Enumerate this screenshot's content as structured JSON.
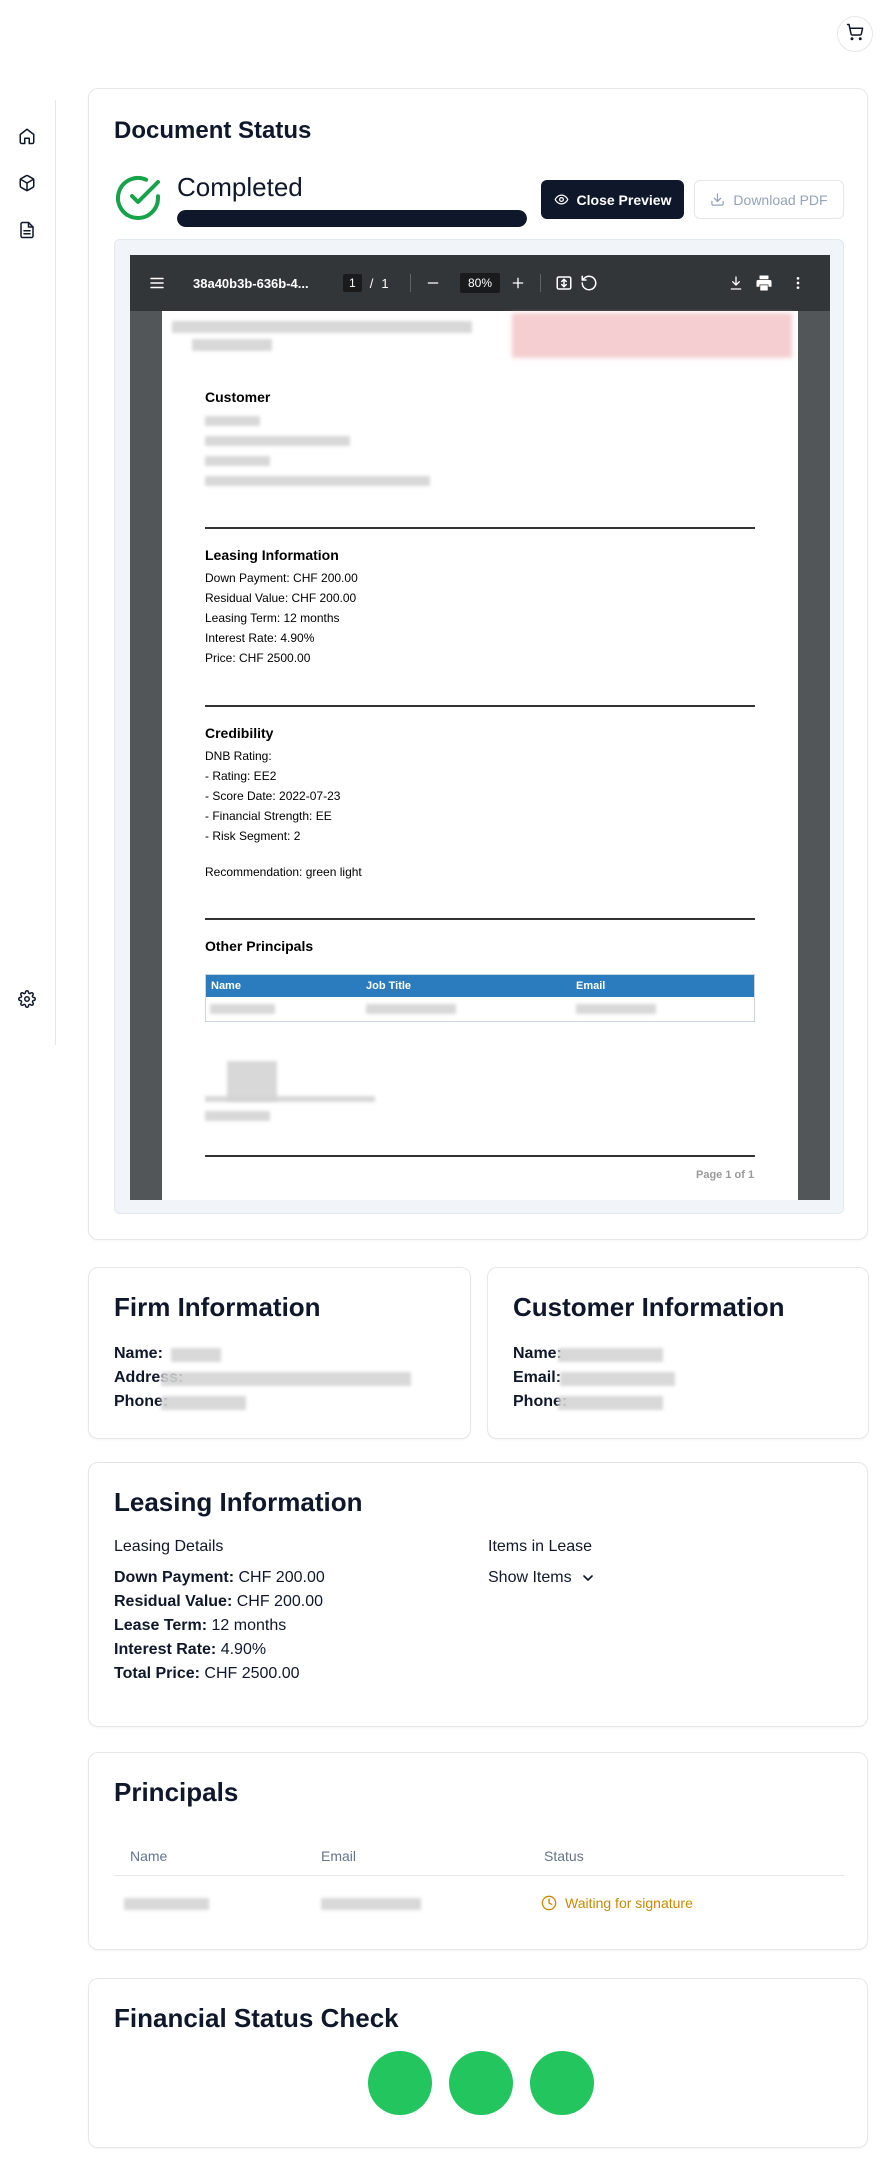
{
  "header": {
    "cart_icon": "cart-icon"
  },
  "sidebar": {
    "items": [
      {
        "icon": "home-icon"
      },
      {
        "icon": "package-icon"
      },
      {
        "icon": "document-icon"
      }
    ],
    "settings_icon": "gear-icon"
  },
  "document_status": {
    "title": "Document Status",
    "status": "Completed",
    "progress": 1.0,
    "close_preview_label": "Close Preview",
    "download_pdf_label": "Download PDF",
    "viewer": {
      "file_name": "38a40b3b-636b-4...",
      "page_current": "1",
      "page_sep": "/",
      "page_total": "1",
      "zoom": "80%"
    },
    "pdf": {
      "customer_heading": "Customer",
      "leasing_heading": "Leasing Information",
      "leasing_lines": [
        "Down Payment: CHF 200.00",
        "Residual Value: CHF 200.00",
        "Leasing Term: 12 months",
        "Interest Rate: 4.90%",
        "Price: CHF 2500.00"
      ],
      "credibility_heading": "Credibility",
      "credibility_lines": [
        "DNB Rating:",
        "- Rating: EE2",
        "- Score Date: 2022-07-23",
        "- Financial Strength: EE",
        "- Risk Segment: 2"
      ],
      "recommendation": "Recommendation: green light",
      "principals_heading": "Other Principals",
      "table_headers": [
        "Name",
        "Job Title",
        "Email"
      ],
      "footer": "Page 1 of 1"
    }
  },
  "firm_info": {
    "title": "Firm Information",
    "name_label": "Name:",
    "address_label": "Address:",
    "phone_label": "Phone:"
  },
  "customer_info": {
    "title": "Customer Information",
    "name_label": "Name:",
    "email_label": "Email:",
    "phone_label": "Phone:"
  },
  "leasing_info": {
    "title": "Leasing Information",
    "details_heading": "Leasing Details",
    "items_heading": "Items in Lease",
    "show_items_label": "Show Items",
    "rows": [
      {
        "label": "Down Payment:",
        "value": "CHF 200.00"
      },
      {
        "label": "Residual Value:",
        "value": "CHF 200.00"
      },
      {
        "label": "Lease Term:",
        "value": "12 months"
      },
      {
        "label": "Interest Rate:",
        "value": "4.90%"
      },
      {
        "label": "Total Price:",
        "value": "CHF 2500.00"
      }
    ]
  },
  "principals": {
    "title": "Principals",
    "columns": [
      "Name",
      "Email",
      "Status"
    ],
    "rows": [
      {
        "status": "Waiting for signature"
      }
    ],
    "status_color": "#ca8a04"
  },
  "financial_status": {
    "title": "Financial Status Check",
    "indicator_color": "#22c55e"
  }
}
